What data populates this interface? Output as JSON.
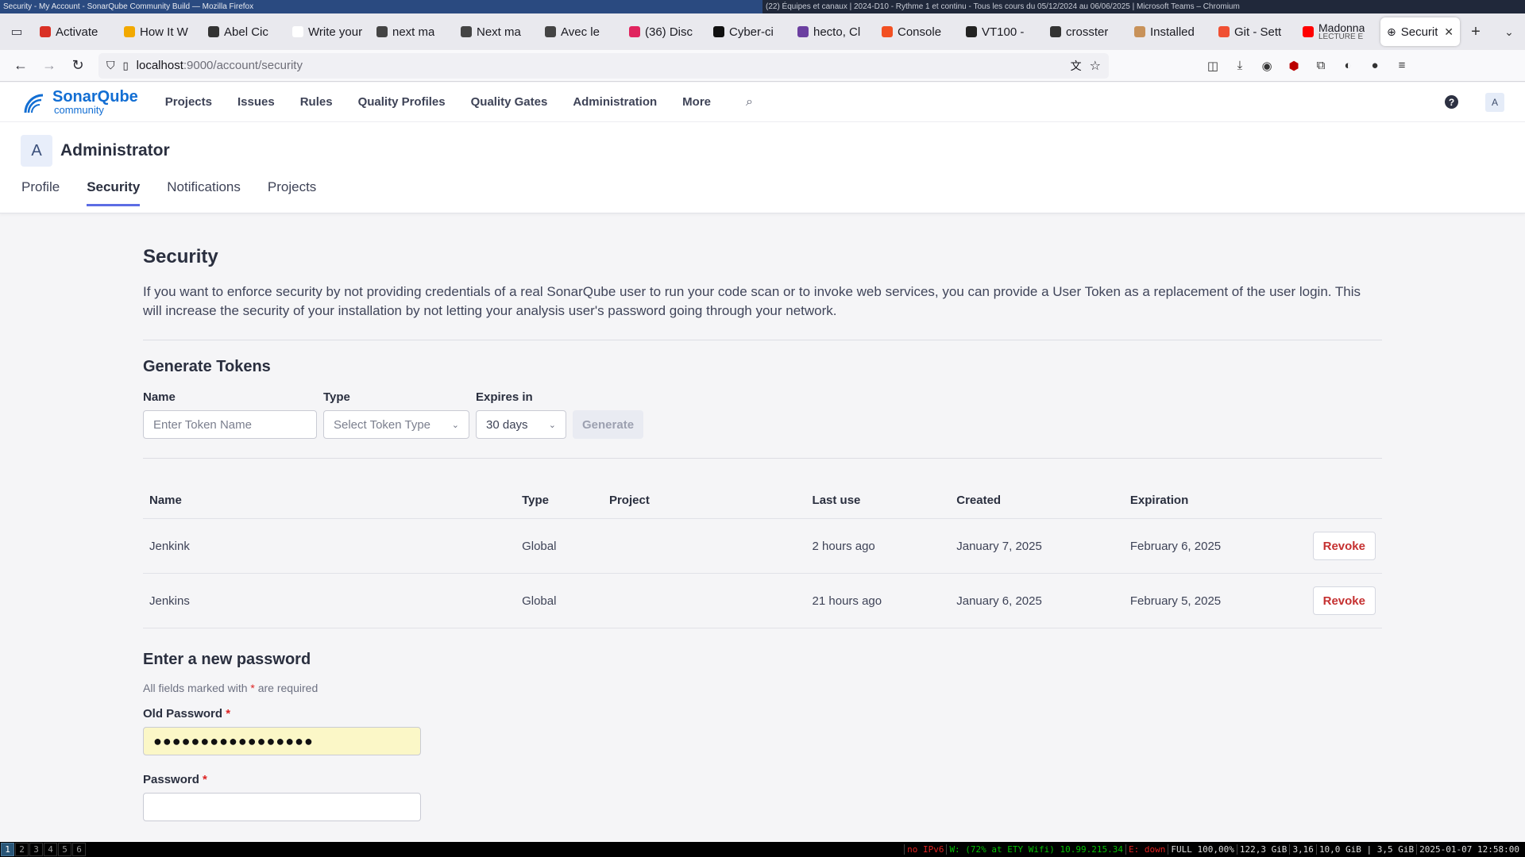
{
  "wm": {
    "left_title": "Security - My Account - SonarQube Community Build — Mozilla Firefox",
    "right_title": "(22) Équipes et canaux | 2024-D10 - Rythme 1 et continu - Tous les cours du 05/12/2024 au 06/06/2025 | Microsoft Teams – Chromium"
  },
  "tabs": [
    {
      "label": "Activate",
      "color": "#d93025"
    },
    {
      "label": "How It W",
      "color": "#f2a900"
    },
    {
      "label": "Abel Cic",
      "color": "#333333"
    },
    {
      "label": "Write your",
      "color": "#ffffff"
    },
    {
      "label": "next ma",
      "color": "#444444"
    },
    {
      "label": "Next ma",
      "color": "#444444"
    },
    {
      "label": "Avec le",
      "color": "#444444"
    },
    {
      "label": "(36) Disc",
      "color": "#e0245e"
    },
    {
      "label": "Cyber-ci",
      "color": "#111111"
    },
    {
      "label": "hecto, Cl",
      "color": "#6b3fa0"
    },
    {
      "label": "Console",
      "color": "#f25022"
    },
    {
      "label": "VT100 -",
      "color": "#222222"
    },
    {
      "label": "crosster",
      "color": "#333333"
    },
    {
      "label": "Installed",
      "color": "#c8925a"
    },
    {
      "label": "Git - Sett",
      "color": "#f05033"
    },
    {
      "label": "Madonna",
      "sub": "LECTURE E",
      "color": "#ff0000"
    }
  ],
  "active_tab": {
    "label": "Securit"
  },
  "nav": {
    "url_host": "localhost",
    "url_path": ":9000/account/security"
  },
  "sq": {
    "brand": "SonarQube",
    "brand_sub": "community",
    "menu": [
      "Projects",
      "Issues",
      "Rules",
      "Quality Profiles",
      "Quality Gates",
      "Administration",
      "More"
    ],
    "user_initial": "A",
    "account_name": "Administrator",
    "account_tabs": [
      "Profile",
      "Security",
      "Notifications",
      "Projects"
    ],
    "active_account_tab": "Security"
  },
  "security": {
    "title": "Security",
    "description": "If you want to enforce security by not providing credentials of a real SonarQube user to run your code scan or to invoke web services, you can provide a User Token as a replacement of the user login. This will increase the security of your installation by not letting your analysis user's password going through your network.",
    "generate_title": "Generate Tokens",
    "name_label": "Name",
    "name_placeholder": "Enter Token Name",
    "type_label": "Type",
    "type_placeholder": "Select Token Type",
    "expires_label": "Expires in",
    "expires_value": "30 days",
    "generate_button": "Generate"
  },
  "tokens": {
    "headers": [
      "Name",
      "Type",
      "Project",
      "Last use",
      "Created",
      "Expiration",
      ""
    ],
    "rows": [
      {
        "name": "Jenkink",
        "type": "Global",
        "project": "",
        "last_use": "2 hours ago",
        "created": "January 7, 2025",
        "expiration": "February 6, 2025",
        "action": "Revoke"
      },
      {
        "name": "Jenkins",
        "type": "Global",
        "project": "",
        "last_use": "21 hours ago",
        "created": "January 6, 2025",
        "expiration": "February 5, 2025",
        "action": "Revoke"
      }
    ]
  },
  "password": {
    "title": "Enter a new password",
    "note_pre": "All fields marked with",
    "note_star": "*",
    "note_post": "are required",
    "old_label": "Old Password",
    "old_value": "●●●●●●●●●●●●●●●●●",
    "new_label": "Password",
    "required_mark": "*"
  },
  "statusbar": {
    "workspaces": [
      "1",
      "2",
      "3",
      "4",
      "5",
      "6"
    ],
    "active_workspace": "1",
    "ipv6": "no IPv6",
    "wifi": "W: (72% at ETY Wifi) 10.99.215.34",
    "eth": "E: down",
    "battery": "FULL 100,00%",
    "disk": "122,3 GiB",
    "load": "3,16",
    "mem": "10,0 GiB | 3,5 GiB",
    "clock": "2025-01-07 12:58:00"
  }
}
